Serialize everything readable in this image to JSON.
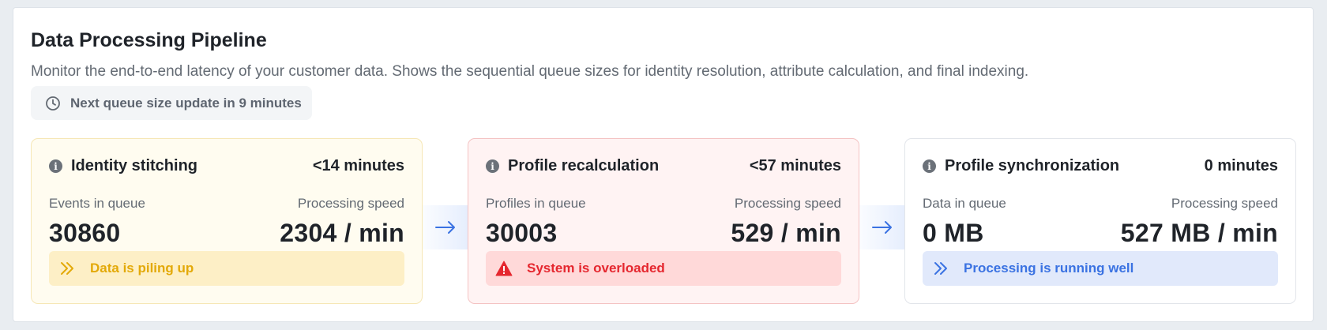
{
  "header": {
    "title": "Data Processing Pipeline",
    "description": "Monitor the end-to-end latency of your customer data. Shows the sequential queue sizes for identity resolution, attribute calculation, and final indexing.",
    "update_text": "Next queue size update in 9 minutes"
  },
  "stages": [
    {
      "name": "Identity stitching",
      "eta": "<14 minutes",
      "queue_label": "Events in queue",
      "queue_value": "30860",
      "speed_label": "Processing speed",
      "speed_value": "2304 / min",
      "status_text": "Data is piling up",
      "status": "warning",
      "status_icon": "double-chevron-right-icon"
    },
    {
      "name": "Profile recalculation",
      "eta": "<57 minutes",
      "queue_label": "Profiles in queue",
      "queue_value": "30003",
      "speed_label": "Processing speed",
      "speed_value": "529 / min",
      "status_text": "System is overloaded",
      "status": "error",
      "status_icon": "warning-triangle-icon"
    },
    {
      "name": "Profile synchronization",
      "eta": "0 minutes",
      "queue_label": "Data in queue",
      "queue_value": "0 MB",
      "speed_label": "Processing speed",
      "speed_value": "527 MB / min",
      "status_text": "Processing is running well",
      "status": "ok",
      "status_icon": "double-chevron-right-icon"
    }
  ],
  "colors": {
    "warning": "#e3a908",
    "error": "#e5272f",
    "ok": "#3a72e2",
    "arrow": "#3a72e2"
  }
}
